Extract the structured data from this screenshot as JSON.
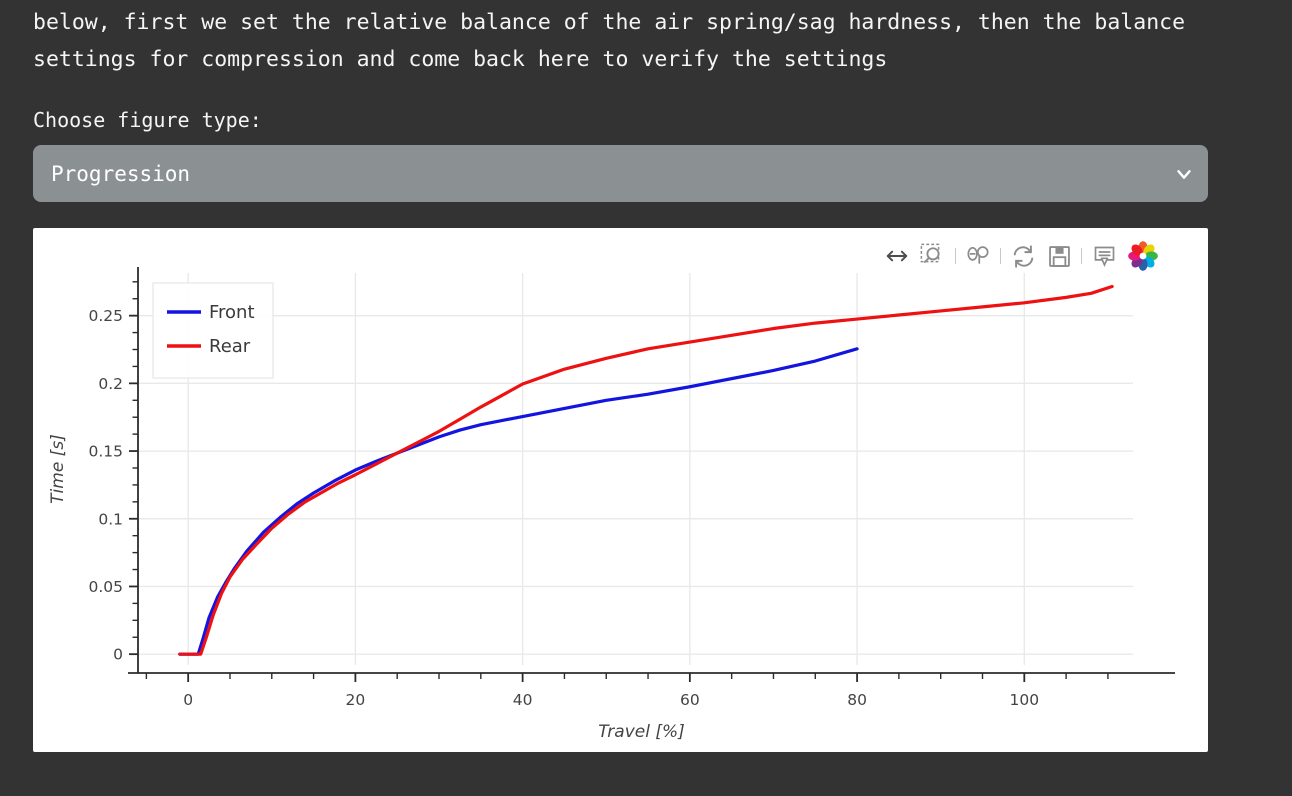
{
  "intro": {
    "text": "below, first we set the relative balance of the air spring/sag hardness, then the balance settings for compression and come back here to verify the settings"
  },
  "controls": {
    "choose_label": "Choose figure type:",
    "figure_select": {
      "value": "Progression",
      "chevron_icon": "chevron-down-icon"
    }
  },
  "modebar": {
    "buttons": [
      {
        "name": "pan-icon",
        "title": "Pan",
        "active": true
      },
      {
        "name": "zoom-box-icon",
        "title": "Box Zoom",
        "active": false
      },
      {
        "name": "zoom-out-icon",
        "title": "Zoom",
        "active": false
      },
      {
        "name": "autoscale-icon",
        "title": "Autoscale",
        "active": false
      },
      {
        "name": "download-icon",
        "title": "Download plot",
        "active": false
      },
      {
        "name": "annotation-icon",
        "title": "Toggle annotations",
        "active": true
      }
    ],
    "logo": "plotly-logo-icon"
  },
  "chart_data": {
    "type": "line",
    "title": "",
    "xlabel": "Travel [%]",
    "ylabel": "Time [s]",
    "xlim": [
      -6,
      113
    ],
    "ylim": [
      -0.008,
      0.2815
    ],
    "xticks": [
      0,
      20,
      40,
      60,
      80,
      100
    ],
    "xticklabels": [
      "0",
      "20",
      "40",
      "60",
      "80",
      "100"
    ],
    "yticks": [
      0,
      0.05,
      0.1,
      0.15,
      0.2,
      0.25
    ],
    "yticklabels": [
      "0",
      "0.05",
      "0.1",
      "0.15",
      "0.2",
      "0.25"
    ],
    "xminor_step": 5,
    "yminor_step": 0.0125,
    "grid": true,
    "grid_color": "#e9e9e9",
    "legend": {
      "position": "top-left",
      "entries": [
        "Front",
        "Rear"
      ]
    },
    "series": [
      {
        "name": "Front",
        "color": "#1414e0",
        "x": [
          -1.0,
          1.2,
          1.8,
          2.5,
          3.5,
          4.5,
          5.5,
          7.0,
          9.0,
          11.0,
          13.0,
          15.0,
          17.5,
          20.0,
          22.5,
          25.0,
          27.5,
          30.0,
          32.5,
          35.0,
          37.5,
          40.0,
          45.0,
          50.0,
          55.0,
          60.0,
          65.0,
          70.0,
          75.0,
          80.0
        ],
        "y": [
          0.0,
          0.0,
          0.012,
          0.027,
          0.042,
          0.053,
          0.063,
          0.076,
          0.09,
          0.101,
          0.111,
          0.119,
          0.128,
          0.136,
          0.1425,
          0.1485,
          0.1545,
          0.1605,
          0.1655,
          0.1695,
          0.1725,
          0.1755,
          0.1815,
          0.1875,
          0.192,
          0.1975,
          0.2035,
          0.2095,
          0.2165,
          0.2255
        ]
      },
      {
        "name": "Rear",
        "color": "#ee1111",
        "x": [
          -1.0,
          1.5,
          2.2,
          3.0,
          4.0,
          5.0,
          6.5,
          8.0,
          10.0,
          12.0,
          14.0,
          16.0,
          18.0,
          20.0,
          22.5,
          25.0,
          27.5,
          30.0,
          32.5,
          35.0,
          37.5,
          40.0,
          45.0,
          50.0,
          55.0,
          60.0,
          65.0,
          70.0,
          75.0,
          80.0,
          85.0,
          90.0,
          95.0,
          100.0,
          105.0,
          108.0,
          110.5
        ],
        "y": [
          0.0,
          0.0,
          0.013,
          0.029,
          0.045,
          0.057,
          0.07,
          0.08,
          0.093,
          0.1035,
          0.1125,
          0.1195,
          0.1265,
          0.1325,
          0.1405,
          0.1485,
          0.1565,
          0.1645,
          0.1735,
          0.1825,
          0.191,
          0.1995,
          0.2105,
          0.2185,
          0.2255,
          0.2305,
          0.2355,
          0.2405,
          0.2445,
          0.2475,
          0.2505,
          0.2535,
          0.2565,
          0.2595,
          0.2635,
          0.2665,
          0.2715
        ]
      }
    ]
  },
  "colors": {
    "page_background": "#333333",
    "select_background": "#8b9192",
    "card_background": "#ffffff",
    "accent_blue": "#29a8e0",
    "front_line": "#1414e0",
    "rear_line": "#ee1111"
  }
}
